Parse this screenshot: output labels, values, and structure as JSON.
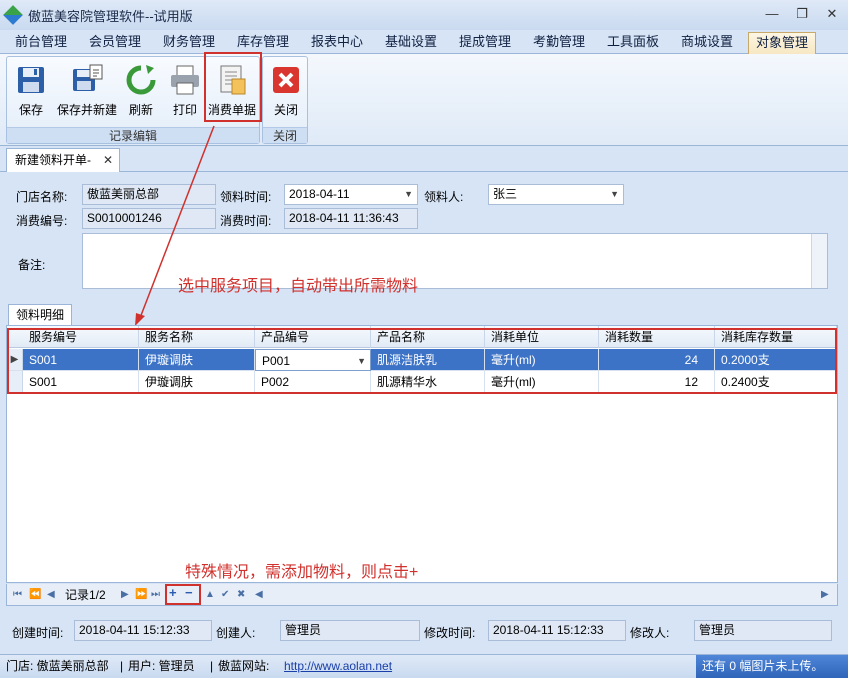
{
  "window": {
    "title": "傲蓝美容院管理软件--试用版"
  },
  "menu_tabs": [
    "前台管理",
    "会员管理",
    "财务管理",
    "库存管理",
    "报表中心",
    "基础设置",
    "提成管理",
    "考勤管理",
    "工具面板",
    "商城设置",
    "对象管理"
  ],
  "ribbon": {
    "group1_caption": "记录编辑",
    "group2_caption": "关闭",
    "save": "保存",
    "save_new": "保存并新建",
    "refresh": "刷新",
    "print": "打印",
    "consume_doc": "消费单据",
    "close": "关闭"
  },
  "doc_tab": {
    "label": "新建领料开单-"
  },
  "form": {
    "store_label": "门店名称:",
    "store_value": "傲蓝美丽总部",
    "pick_time_label": "领料时间:",
    "pick_time_value": "2018-04-11",
    "picker_label": "领料人:",
    "picker_value": "张三",
    "consume_no_label": "消费编号:",
    "consume_no_value": "S0010001246",
    "consume_time_label": "消费时间:",
    "consume_time_value": "2018-04-11 11:36:43",
    "remark_label": "备注:"
  },
  "annotations": {
    "top": "选中服务项目，自动带出所需物料",
    "bottom": "特殊情况，需添加物料，则点击+"
  },
  "detail_tab": "领料明细",
  "grid": {
    "columns": [
      "服务编号",
      "服务名称",
      "产品编号",
      "产品名称",
      "消耗单位",
      "消耗数量",
      "消耗库存数量"
    ],
    "rows": [
      [
        "S001",
        "伊璇调肤",
        "P001",
        "肌源洁肤乳",
        "毫升(ml)",
        "24",
        "0.2000支"
      ],
      [
        "S001",
        "伊璇调肤",
        "P002",
        "肌源精华水",
        "毫升(ml)",
        "12",
        "0.2400支"
      ]
    ]
  },
  "navigator": {
    "record_text": "记录1/2",
    "plus": "+",
    "minus": "−"
  },
  "footer": {
    "created_time_label": "创建时间:",
    "created_time_value": "2018-04-11 15:12:33",
    "creator_label": "创建人:",
    "creator_value": "管理员",
    "modified_time_label": "修改时间:",
    "modified_time_value": "2018-04-11 15:12:33",
    "modifier_label": "修改人:",
    "modifier_value": "管理员"
  },
  "status": {
    "store": "门店: 傲蓝美丽总部",
    "user": "用户: 管理员",
    "site_label": "傲蓝网站:",
    "site_url": "http://www.aolan.net",
    "right": "还有 0 幅图片未上传。"
  }
}
